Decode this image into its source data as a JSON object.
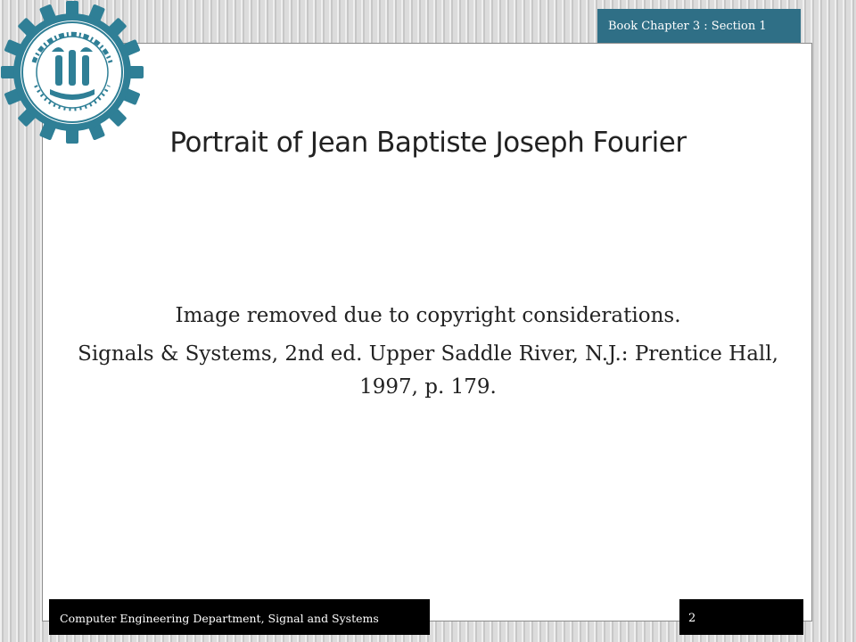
{
  "header": {
    "chapter_label": "Book Chapter 3 : Section 1"
  },
  "logo": {
    "name": "university-seal",
    "text": "دانشگاه صنعتی شریف",
    "color": "#2f7f96"
  },
  "slide": {
    "title": "Portrait of Jean Baptiste Joseph Fourier",
    "notice": "Image removed due to copyright considerations.",
    "citation": "Signals & Systems, 2nd ed. Upper Saddle River, N.J.: Prentice Hall, 1997, p. 179."
  },
  "footer": {
    "department": "Computer Engineering Department, Signal and Systems",
    "page_number": "2"
  },
  "colors": {
    "accent": "#2f6f86",
    "footer_bg": "#000000"
  }
}
